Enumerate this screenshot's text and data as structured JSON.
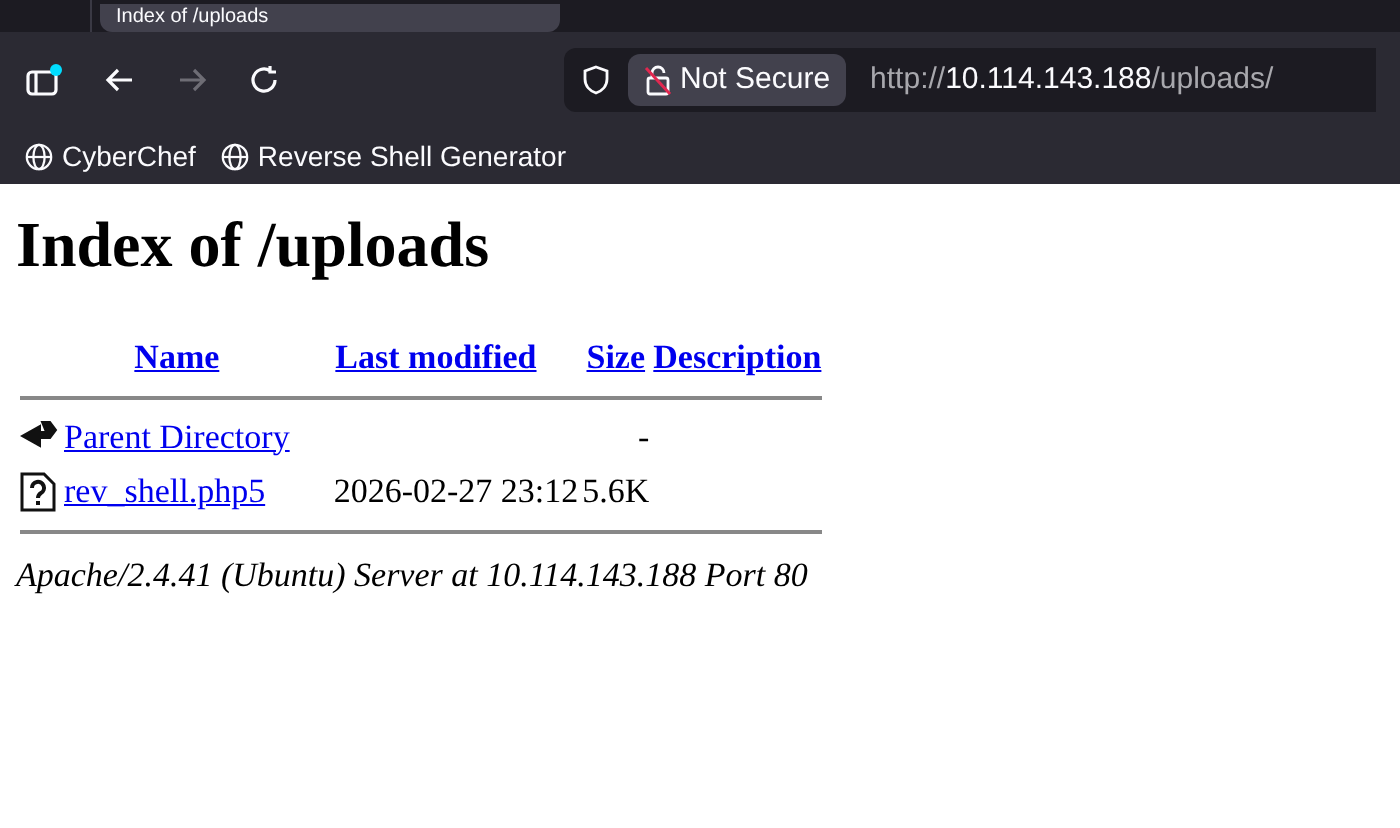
{
  "browser": {
    "tab": {
      "title": "Index of /uploads",
      "selected": true
    },
    "address_bar": {
      "security": "Not Secure",
      "url_prefix": "http://",
      "url_host": "10.114.143.188",
      "url_path": "/uploads/"
    },
    "bookmarks": [
      {
        "label": "CyberChef"
      },
      {
        "label": "Reverse Shell Generator"
      }
    ]
  },
  "page": {
    "heading": "Index of /uploads",
    "columns": [
      "Name",
      "Last modified",
      "Size",
      "Description"
    ],
    "rows": [
      {
        "kind": "parent",
        "name": "Parent Directory",
        "modified": "",
        "size": "-",
        "description": ""
      },
      {
        "kind": "file",
        "name": "rev_shell.php5",
        "modified": "2026-02-27 23:12",
        "size": "5.6K",
        "description": ""
      }
    ],
    "footer": "Apache/2.4.41 (Ubuntu) Server at 10.114.143.188 Port 80"
  }
}
